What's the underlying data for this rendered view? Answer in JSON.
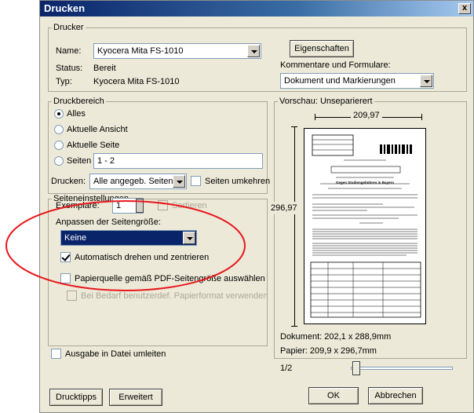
{
  "window": {
    "title": "Drucken",
    "close_label": "x"
  },
  "printer": {
    "group_title": "Drucker",
    "name_label": "Name:",
    "name_value": "Kyocera Mita FS-1010",
    "status_label": "Status:",
    "status_value": "Bereit",
    "type_label": "Typ:",
    "type_value": "Kyocera Mita FS-1010",
    "properties_button": "Eigenschaften",
    "comments_label": "Kommentare und Formulare:",
    "comments_value": "Dokument und Markierungen"
  },
  "range": {
    "group_title": "Druckbereich",
    "all": "Alles",
    "current_view": "Aktuelle Ansicht",
    "current_page": "Aktuelle Seite",
    "pages": "Seiten",
    "pages_value": "1 - 2",
    "print_label": "Drucken:",
    "print_value": "Alle angegeb. Seiten",
    "reverse": "Seiten umkehren"
  },
  "page_settings": {
    "group_title": "Seiteneinstellungen",
    "copies_label": "Exemplare:",
    "copies_value": "1",
    "collate": "Sortieren",
    "fit_label": "Anpassen der Seitengröße:",
    "fit_value": "Keine",
    "auto_rotate": "Automatisch drehen und zentrieren",
    "paper_source": "Papierquelle gemäß PDF-Seitengröße auswählen",
    "custom_paper": "Bei Bedarf benutzerdef. Papierformat verwenden"
  },
  "preview": {
    "group_title": "Vorschau: Unseparierert",
    "width": "209,97",
    "height": "296,97",
    "document_size": "Dokument: 202,1 x 288,9mm",
    "paper_size": "Papier: 209,9 x 296,7mm",
    "page_indicator": "1/2",
    "page_heading": "Gegen Studiengebühren in Bayern",
    "page_subheading": "ANTRAG auf Zulassung des Volksbegehrens"
  },
  "print_to_file": "Ausgabe in Datei umleiten",
  "buttons": {
    "tips": "Drucktipps",
    "advanced": "Erweitert",
    "ok": "OK",
    "cancel": "Abbrechen"
  },
  "colors": {
    "annotation_ellipse": "#e8171b",
    "selection": "#0a246a"
  }
}
